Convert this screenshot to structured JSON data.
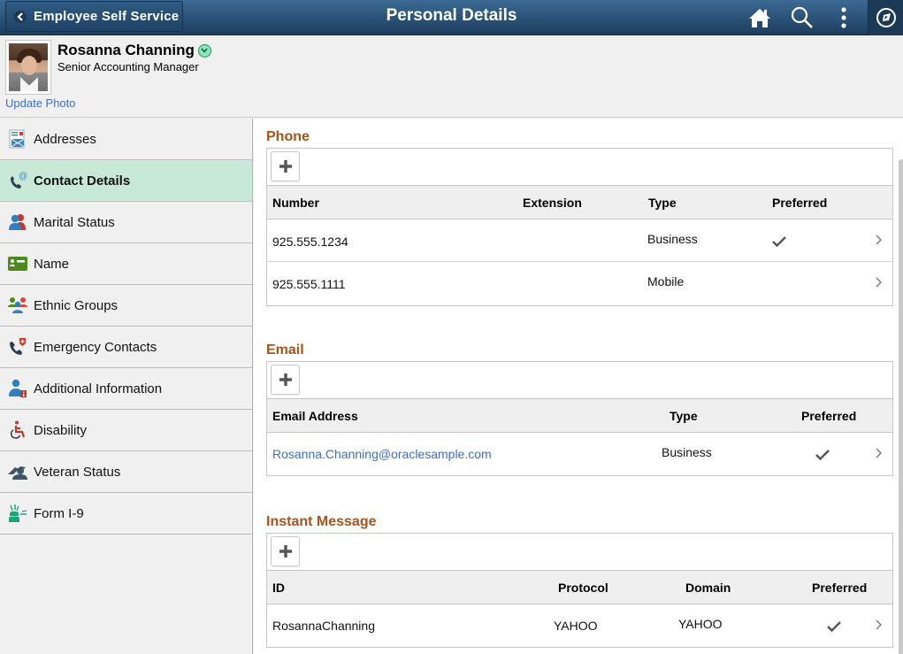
{
  "header": {
    "back_label": "Employee Self Service",
    "title": "Personal Details",
    "icons": [
      "home-icon",
      "search-icon",
      "actions-menu-icon",
      "navbar-compass-icon"
    ]
  },
  "profile": {
    "name": "Rosanna Channing",
    "job_title": "Senior Accounting Manager",
    "update_photo_label": "Update Photo"
  },
  "sidebar": {
    "active_index": 1,
    "items": [
      {
        "label": "Addresses",
        "icon": "addresses-icon"
      },
      {
        "label": "Contact Details",
        "icon": "contact-details-icon"
      },
      {
        "label": "Marital Status",
        "icon": "marital-status-icon"
      },
      {
        "label": "Name",
        "icon": "name-card-icon"
      },
      {
        "label": "Ethnic Groups",
        "icon": "ethnic-groups-icon"
      },
      {
        "label": "Emergency Contacts",
        "icon": "emergency-contacts-icon"
      },
      {
        "label": "Additional Information",
        "icon": "additional-info-icon"
      },
      {
        "label": "Disability",
        "icon": "disability-icon"
      },
      {
        "label": "Veteran Status",
        "icon": "veteran-status-icon"
      },
      {
        "label": "Form I-9",
        "icon": "form-i9-icon"
      }
    ]
  },
  "colors": {
    "header_dark": "#1d3d5e",
    "section_title": "#a4541c",
    "link": "#3a6fc8",
    "active_nav": "#c8e9d8"
  },
  "phone": {
    "title": "Phone",
    "add_label": "+",
    "columns": [
      "Number",
      "Extension",
      "Type",
      "Preferred"
    ],
    "rows": [
      {
        "number": "925.555.1234",
        "extension": "",
        "type": "Business",
        "preferred": true
      },
      {
        "number": "925.555.1111",
        "extension": "",
        "type": "Mobile",
        "preferred": false
      }
    ]
  },
  "email": {
    "title": "Email",
    "add_label": "+",
    "columns": [
      "Email Address",
      "Type",
      "Preferred"
    ],
    "rows": [
      {
        "address": "Rosanna.Channing@oraclesample.com",
        "type": "Business",
        "preferred": true
      }
    ]
  },
  "instant_message": {
    "title": "Instant Message",
    "add_label": "+",
    "columns": [
      "ID",
      "Protocol",
      "Domain",
      "Preferred"
    ],
    "rows": [
      {
        "id": "RosannaChanning",
        "protocol": "YAHOO",
        "domain": "YAHOO",
        "preferred": true
      }
    ]
  }
}
